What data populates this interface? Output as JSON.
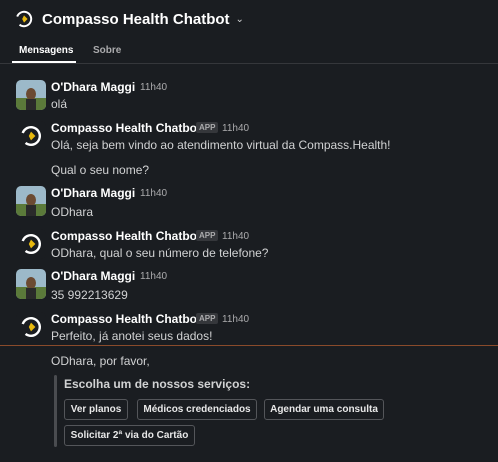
{
  "header": {
    "title": "Compasso Health Chatbot"
  },
  "tabs": [
    {
      "label": "Mensagens",
      "active": true
    },
    {
      "label": "Sobre",
      "active": false
    }
  ],
  "user": {
    "name": "O'Dhara Maggi"
  },
  "bot": {
    "name": "Compasso Health Chatbot",
    "badge": "APP"
  },
  "messages": [
    {
      "sender": "user",
      "time": "11h40",
      "lines": [
        "olá"
      ]
    },
    {
      "sender": "bot",
      "time": "11h40",
      "lines": [
        "Olá, seja bem vindo ao atendimento virtual da Compass.Health!",
        "Qual o seu nome?"
      ]
    },
    {
      "sender": "user",
      "time": "11h40",
      "lines": [
        "ODhara"
      ]
    },
    {
      "sender": "bot",
      "time": "11h40",
      "lines": [
        "ODhara, qual o seu número de telefone?"
      ]
    },
    {
      "sender": "user",
      "time": "11h40",
      "lines": [
        "35 992213629"
      ]
    },
    {
      "sender": "bot",
      "time": "11h40",
      "lines": [
        "Perfeito, já anotei seus dados!"
      ]
    }
  ],
  "prompt": {
    "intro": "ODhara, por favor,",
    "title": "Escolha um de nossos serviços:",
    "buttons": [
      "Ver planos",
      "Médicos credenciados",
      "Agendar uma consulta",
      "Solicitar 2ª via do Cartão"
    ]
  },
  "colors": {
    "background": "#1a1d21",
    "divider": "#8a4b2b",
    "logo_yellow": "#e8b90e"
  }
}
